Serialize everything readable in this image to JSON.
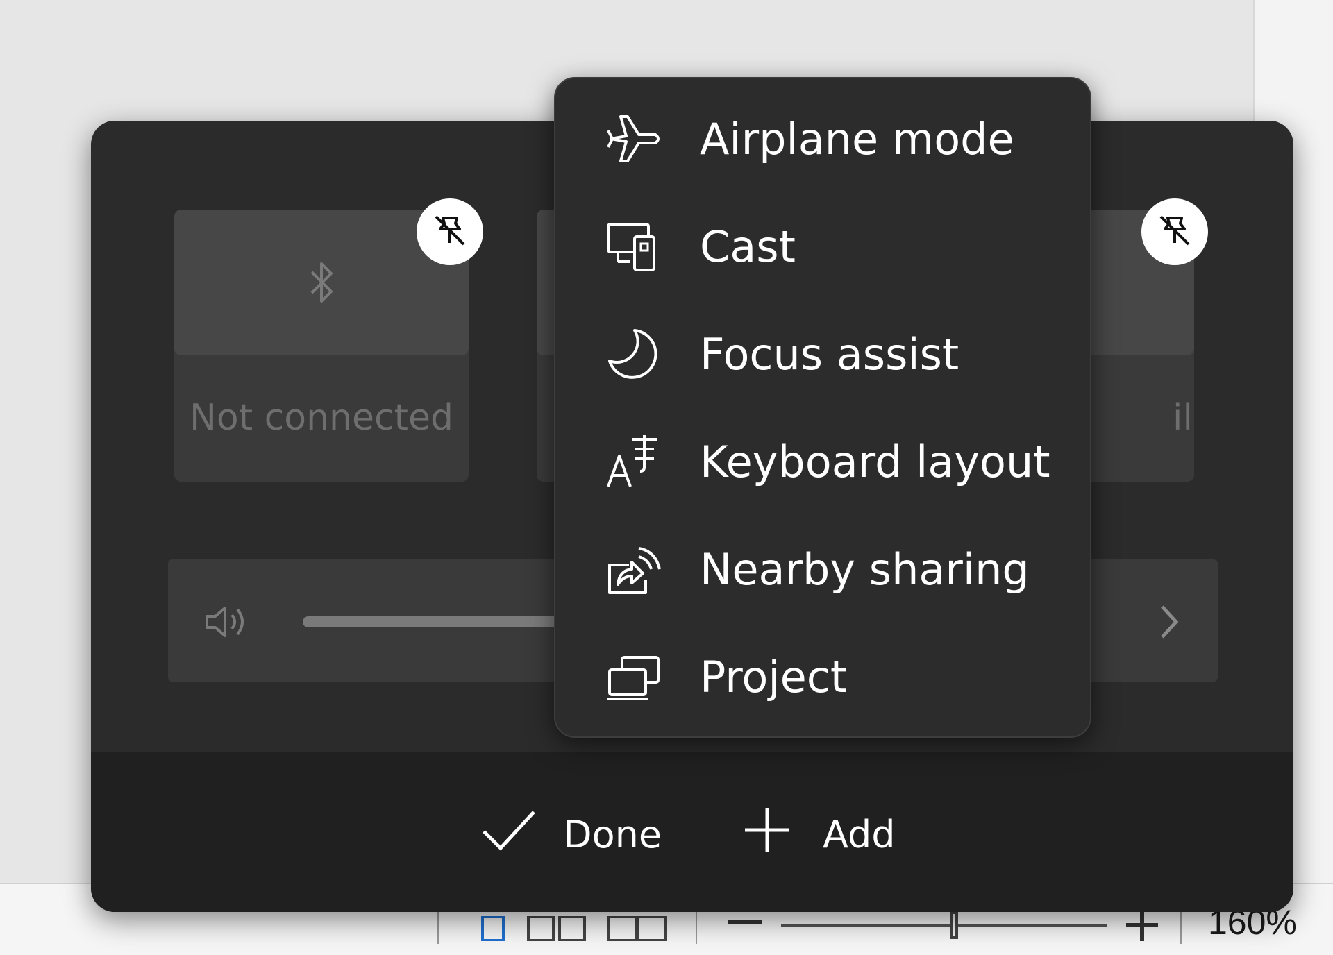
{
  "quick_settings": {
    "tiles": [
      {
        "label": "Not connected",
        "icon": "bluetooth-icon"
      },
      {
        "label": "",
        "icon": ""
      },
      {
        "label": "ility",
        "icon": ""
      }
    ],
    "volume": {
      "icon": "speaker-icon",
      "level_percent": 45
    }
  },
  "context_menu": {
    "items": [
      {
        "label": "Airplane mode",
        "icon": "airplane-icon"
      },
      {
        "label": "Cast",
        "icon": "cast-icon"
      },
      {
        "label": "Focus assist",
        "icon": "moon-icon"
      },
      {
        "label": "Keyboard layout",
        "icon": "keyboard-layout-icon"
      },
      {
        "label": "Nearby sharing",
        "icon": "nearby-share-icon"
      },
      {
        "label": "Project",
        "icon": "project-icon"
      }
    ]
  },
  "footer": {
    "done_label": "Done",
    "add_label": "Add"
  },
  "status_bar": {
    "zoom_percent": "160%"
  },
  "colors": {
    "panel_bg": "#2b2b2b",
    "menu_bg": "#2c2c2c",
    "footer_bg": "#202020",
    "tile_bg": "#3a3a3a"
  }
}
